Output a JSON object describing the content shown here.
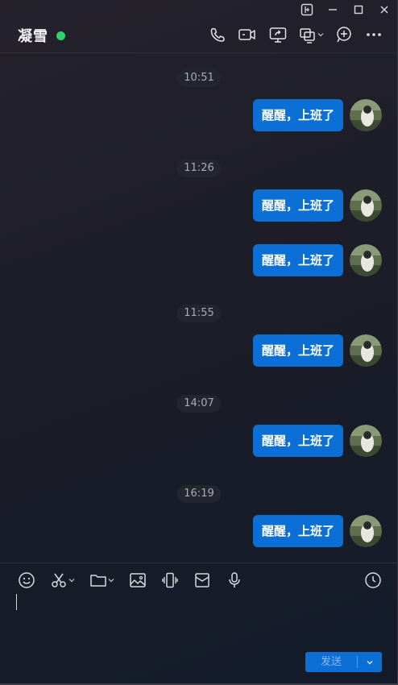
{
  "window": {
    "controls": [
      "pin-icon",
      "minimize-icon",
      "maximize-icon",
      "close-icon"
    ]
  },
  "header": {
    "contact_name": "凝雪",
    "status": "online",
    "status_color": "#2fd36b",
    "tools": [
      "phone-icon",
      "video-call-icon",
      "screen-share-icon",
      "remote-assist-icon",
      "add-member-icon",
      "more-icon"
    ]
  },
  "chat": {
    "bubble_color": "#0c6fd6",
    "groups": [
      {
        "time": "10:51",
        "messages": [
          "醒醒，上班了"
        ]
      },
      {
        "time": "11:26",
        "messages": [
          "醒醒，上班了",
          "醒醒，上班了"
        ]
      },
      {
        "time": "11:55",
        "messages": [
          "醒醒，上班了"
        ]
      },
      {
        "time": "14:07",
        "messages": [
          "醒醒，上班了"
        ]
      },
      {
        "time": "16:19",
        "messages": [
          "醒醒，上班了"
        ]
      }
    ]
  },
  "composer": {
    "tools": [
      "emoji-icon",
      "screenshot-icon",
      "folder-icon",
      "image-icon",
      "shake-icon",
      "red-packet-icon",
      "voice-icon"
    ],
    "history_icon": "clock-icon",
    "input_value": "",
    "send_label": "发送"
  }
}
